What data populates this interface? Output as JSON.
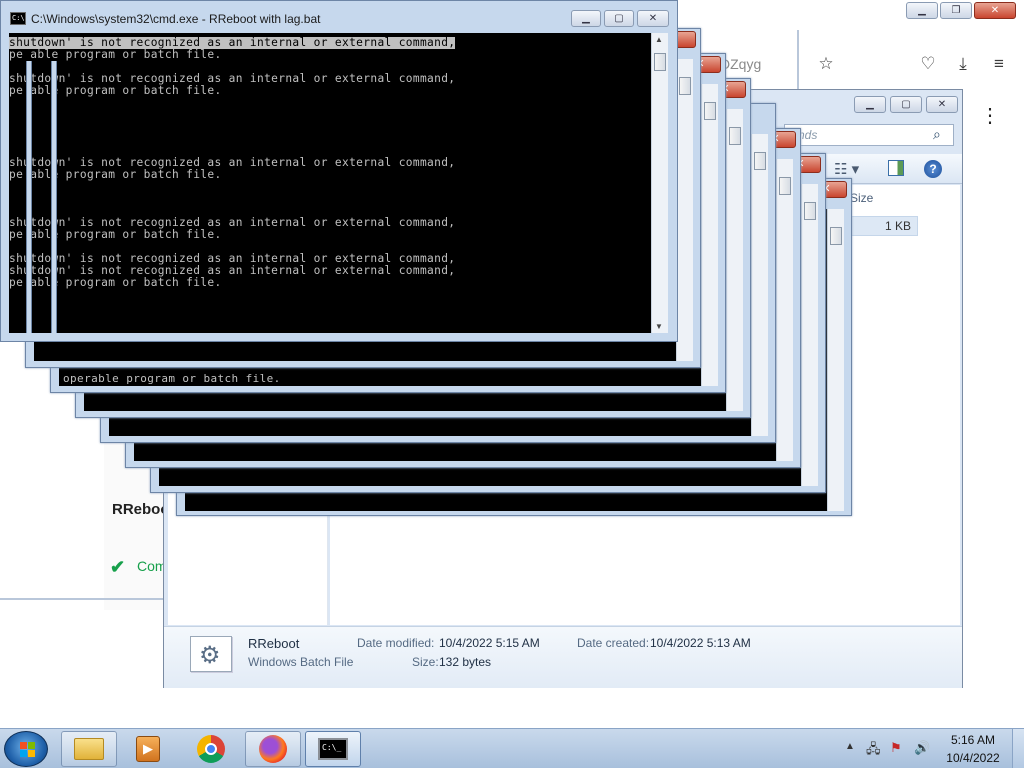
{
  "firefox": {
    "url_fragment": "DZqyg",
    "card_title": "RReboo",
    "status_text": "Com",
    "icons": [
      "star-icon",
      "pocket-icon",
      "download-icon",
      "hamburger-menu-icon",
      "kebab-menu-icon",
      "checkmark-icon"
    ]
  },
  "explorer": {
    "search_placeholder": "nds",
    "column_size": "Size",
    "file_size_cell": "1 KB",
    "details": {
      "name": "RReboot",
      "type": "Windows Batch File",
      "date_modified_label": "Date modified:",
      "date_modified": "10/4/2022 5:15 AM",
      "date_created_label": "Date created:",
      "date_created": "10/4/2022 5:13 AM",
      "size_label": "Size:",
      "size": "132 bytes"
    }
  },
  "cmd": {
    "title": "C:\\Windows\\system32\\cmd.exe - RReboot  with lag.bat",
    "lines": [
      "shutdown' is not recognized as an internal or external command,",
      "pe able program or batch file.",
      "shutdown' is not recognized as an internal or external command,",
      "pe able program or batch file.",
      "shutdown' is not recognized as an internal or external command,",
      "pe able program or batch file.",
      "shutdown' is not recognized as an internal or external command,",
      "pe able program or batch file.",
      "shutdown' is not recognized as an internal or external command,",
      "shutdown' is not recognized as an internal or external command,",
      "pe able program or batch file."
    ],
    "background_line": "operable program or batch file."
  },
  "taskbar": {
    "clock_time": "5:16 AM",
    "clock_date": "10/4/2022",
    "apps": [
      "windows-explorer",
      "media-player",
      "google-chrome",
      "firefox",
      "command-prompt"
    ]
  },
  "colors": {
    "taskbar": "#b5cbe4",
    "window_frame": "#c6d8ed",
    "console_bg": "#000000",
    "console_text": "#c0c0c0",
    "close_red": "#c9452f"
  }
}
